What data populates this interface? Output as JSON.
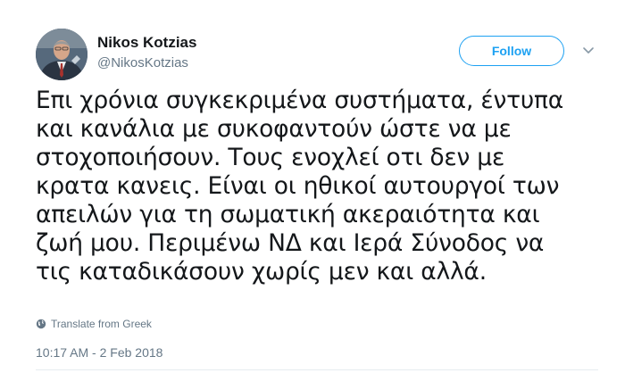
{
  "author": {
    "name": "Nikos Kotzias",
    "handle": "@NikosKotzias",
    "avatar_icon": "profile-photo"
  },
  "actions": {
    "follow_label": "Follow",
    "menu_icon": "chevron-down-icon"
  },
  "tweet": {
    "lines": [
      "Επι χρόνια συγκεκριμένα συστήματα, έντυπα",
      "και κανάλια με συκοφαντούν ώστε να με",
      "στοχοποιήσουν. Τους ενοχλεί οτι δεν με",
      "κρατα κανεις. Είναι οι ηθικοί αυτουργοί των",
      "απειλών για τη σωματική ακεραιότητα και",
      "ζωή μου. Περιμένω ΝΔ και Ιερά Σύνοδος να",
      "τις καταδικάσουν χωρίς μεν και αλλά."
    ],
    "translate_label": "Translate from Greek",
    "timestamp": "10:17 AM - 2 Feb 2018"
  },
  "colors": {
    "accent": "#1da1f2",
    "text": "#14171a",
    "secondary": "#657786"
  }
}
